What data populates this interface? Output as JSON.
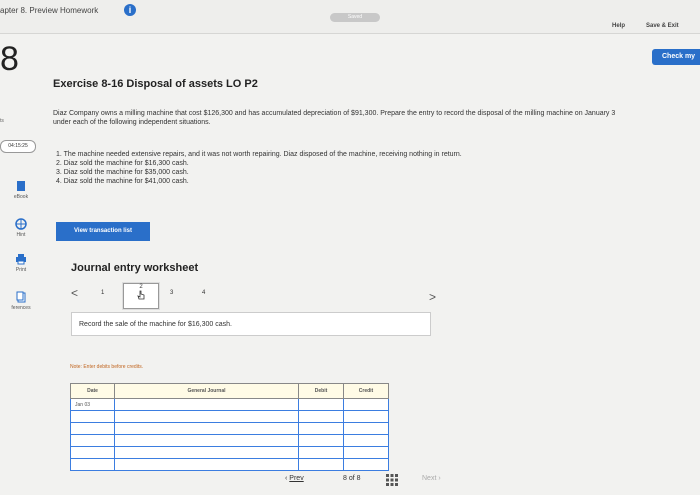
{
  "topbar": {
    "chapter_title": "apter 8. Preview Homework",
    "saved_label": "Saved",
    "help_label": "Help",
    "save_exit_label": "Save & Exit"
  },
  "check_label": "Check my",
  "question_number": "8",
  "sidebar": {
    "fragment": "ts",
    "timer": "04:15:25",
    "items": [
      {
        "label": "eBook",
        "icon": "book-icon"
      },
      {
        "label": "Hint",
        "icon": "hint-icon"
      },
      {
        "label": "Print",
        "icon": "print-icon"
      },
      {
        "label": "ferences",
        "icon": "references-icon"
      }
    ]
  },
  "exercise": {
    "title": "Exercise 8-16 Disposal of assets LO P2",
    "description": "Diaz Company owns a milling machine that cost $126,300 and has accumulated depreciation of $91,300. Prepare the entry to record the disposal of the milling machine on January 3 under each of the following independent situations.",
    "conditions": [
      "1. The machine needed extensive repairs, and it was not worth repairing. Diaz disposed of the machine, receiving nothing in return.",
      "2. Diaz sold the machine for $16,300 cash.",
      "3. Diaz sold the machine for $35,000 cash.",
      "4. Diaz sold the machine for $41,000 cash."
    ]
  },
  "view_transaction_label": "View transaction list",
  "worksheet": {
    "title": "Journal entry worksheet",
    "prev_arrow": "<",
    "next_arrow": ">",
    "pages": [
      "1",
      "2",
      "3",
      "4"
    ],
    "instruction": "Record the sale of the machine for $16,300 cash.",
    "note": "Note: Enter debits before credits.",
    "columns": [
      "Date",
      "General Journal",
      "Debit",
      "Credit"
    ],
    "rows": [
      [
        "Jan 03",
        "",
        "",
        ""
      ],
      [
        "",
        "",
        "",
        ""
      ],
      [
        "",
        "",
        "",
        ""
      ],
      [
        "",
        "",
        "",
        ""
      ],
      [
        "",
        "",
        "",
        ""
      ],
      [
        "",
        "",
        "",
        ""
      ]
    ]
  },
  "bottom_nav": {
    "prev_label": "Prev",
    "page_indicator": "8 of 8",
    "next_label": "Next"
  },
  "colors": {
    "accent": "#2a6fc9",
    "note": "#c0641e",
    "table_border": "#3b7de0",
    "header_bg": "#fffbe6"
  }
}
